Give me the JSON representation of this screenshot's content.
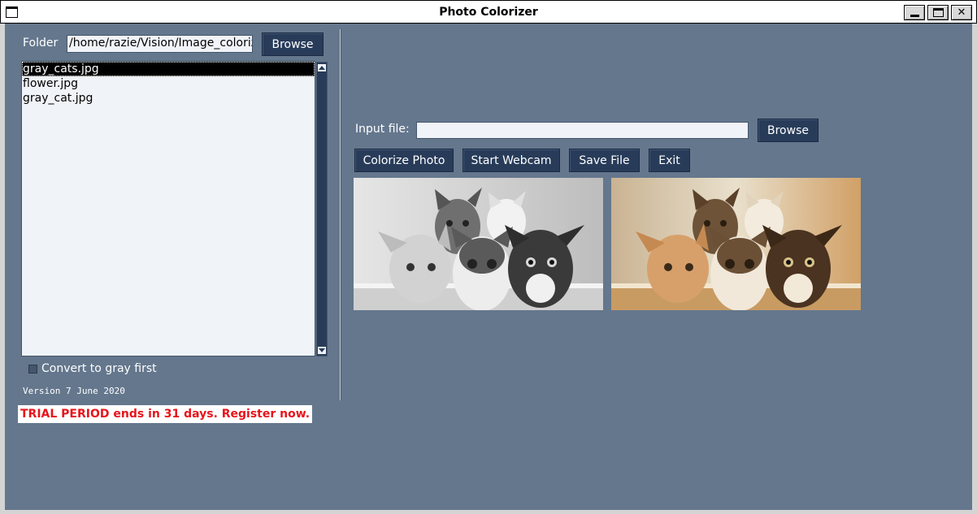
{
  "window": {
    "title": "Photo Colorizer"
  },
  "left_panel": {
    "folder_label": "Folder",
    "folder_path": "/home/razie/Vision/Image_colorization",
    "browse_label": "Browse",
    "files": [
      "gray_cats.jpg",
      "flower.jpg",
      "gray_cat.jpg"
    ],
    "selected_index": 0,
    "convert_gray_label": "Convert to gray first",
    "convert_gray_checked": false,
    "version_text": "Version 7 June 2020",
    "trial_text": "TRIAL PERIOD  ends in 31 days. Register now."
  },
  "right_panel": {
    "input_file_label": "Input file:",
    "input_file_value": "",
    "browse_label": "Browse",
    "buttons": {
      "colorize": "Colorize Photo",
      "webcam": "Start Webcam",
      "save": "Save File",
      "exit": "Exit"
    }
  },
  "colors": {
    "background": "#64778d",
    "button": "#283c5a",
    "entry": "#f0f3f8",
    "trial_text": "#e8141a"
  }
}
